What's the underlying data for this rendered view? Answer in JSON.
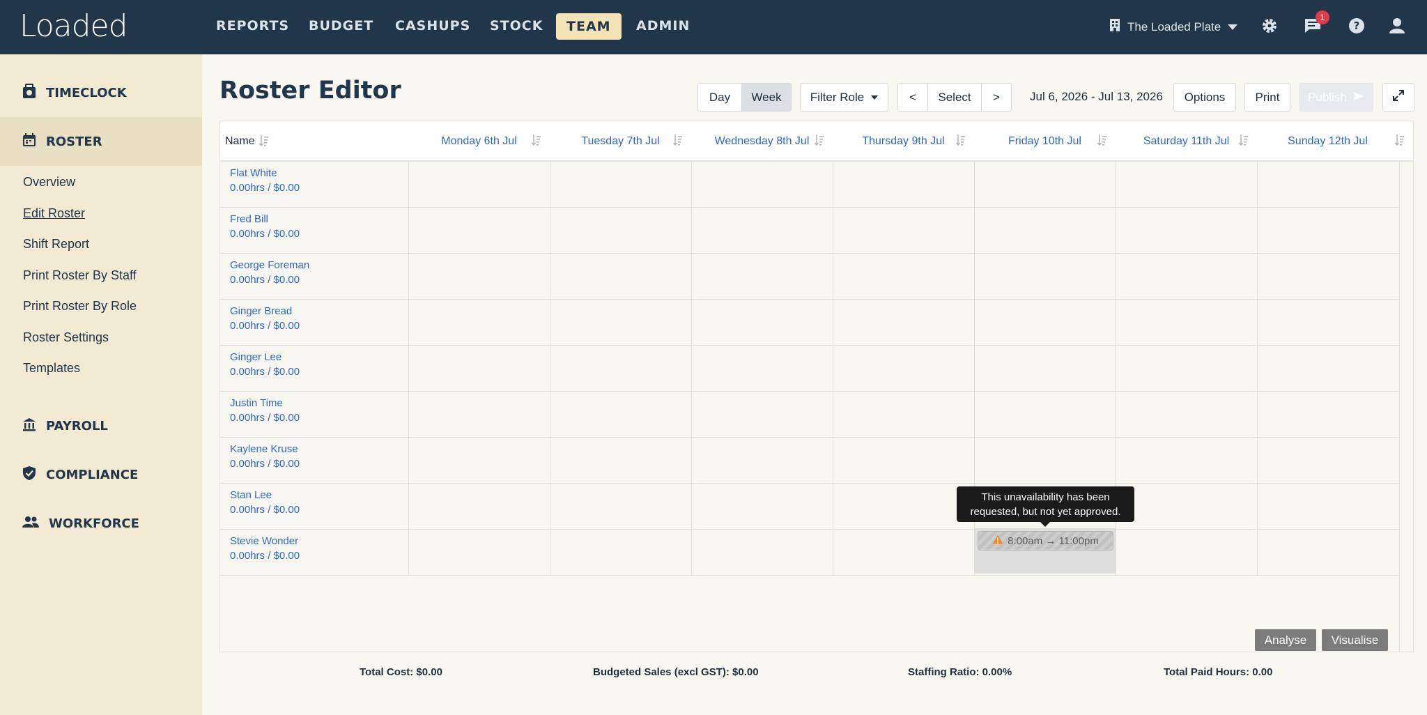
{
  "app": {
    "logo": "Loaded"
  },
  "nav": {
    "items": [
      "REPORTS",
      "BUDGET",
      "CASHUPS",
      "STOCK",
      "TEAM",
      "ADMIN"
    ],
    "active": "TEAM",
    "venue": "The Loaded Plate",
    "notification_count": "1"
  },
  "sidebar": {
    "timeclock": "TIMECLOCK",
    "roster": "ROSTER",
    "links": [
      "Overview",
      "Edit Roster",
      "Shift Report",
      "Print Roster By Staff",
      "Print Roster By Role",
      "Roster Settings",
      "Templates"
    ],
    "current_link": "Edit Roster",
    "payroll": "PAYROLL",
    "compliance": "COMPLIANCE",
    "workforce": "WORKFORCE"
  },
  "toolbar": {
    "title": "Roster Editor",
    "day": "Day",
    "week": "Week",
    "filter_role": "Filter Role",
    "prev": "<",
    "select": "Select",
    "next": ">",
    "date_range": "Jul 6, 2026 - Jul 13, 2026",
    "options": "Options",
    "print": "Print",
    "publish": "Publish"
  },
  "grid": {
    "name_header": "Name",
    "days": [
      "Monday 6th Jul",
      "Tuesday 7th Jul",
      "Wednesday 8th Jul",
      "Thursday 9th Jul",
      "Friday 10th Jul",
      "Saturday 11th Jul",
      "Sunday 12th Jul"
    ],
    "staff": [
      {
        "name": "Flat White",
        "summary": "0.00hrs / $0.00"
      },
      {
        "name": "Fred Bill",
        "summary": "0.00hrs / $0.00"
      },
      {
        "name": "George Foreman",
        "summary": "0.00hrs / $0.00"
      },
      {
        "name": "Ginger Bread",
        "summary": "0.00hrs / $0.00"
      },
      {
        "name": "Ginger Lee",
        "summary": "0.00hrs / $0.00"
      },
      {
        "name": "Justin Time",
        "summary": "0.00hrs / $0.00"
      },
      {
        "name": "Kaylene Kruse",
        "summary": "0.00hrs / $0.00"
      },
      {
        "name": "Stan Lee",
        "summary": "0.00hrs / $0.00"
      },
      {
        "name": "Stevie Wonder",
        "summary": "0.00hrs / $0.00"
      }
    ],
    "unavailability": {
      "staff": "Stevie Wonder",
      "day": "Friday 10th Jul",
      "time": "8:00am → 11:00pm"
    },
    "tooltip_line1": "This unavailability has been",
    "tooltip_line2": "requested, but not yet approved.",
    "analyse": "Analyse",
    "visualise": "Visualise"
  },
  "totals": {
    "cost": "Total Cost: $0.00",
    "budgeted_sales": "Budgeted Sales (excl GST): $0.00",
    "staffing_ratio": "Staffing Ratio: 0.00%",
    "paid_hours": "Total Paid Hours: 0.00"
  },
  "colors": {
    "nav_bg": "#213649",
    "sidebar_bg": "#f2ead3",
    "active_tab": "#f3e3b6",
    "link_blue": "#2e67c8",
    "badge_red": "#e53946"
  }
}
